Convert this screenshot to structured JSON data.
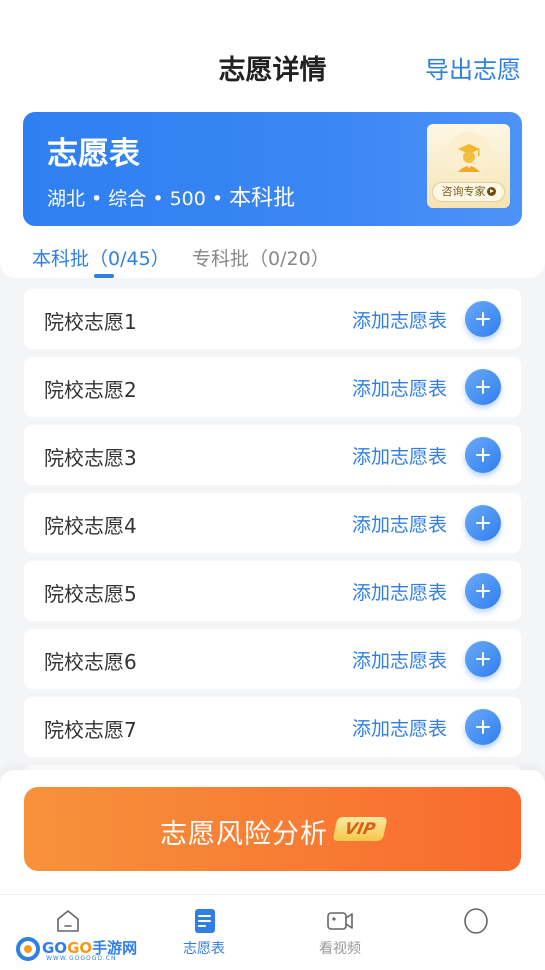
{
  "header": {
    "title": "志愿详情",
    "export_label": "导出志愿"
  },
  "banner": {
    "title": "志愿表",
    "subtitle_small": "湖北 • 综合 • 500 • ",
    "subtitle_big": "本科批",
    "expert_button": "咨询专家"
  },
  "tabs": [
    {
      "label": "本科批（0/45）",
      "active": true
    },
    {
      "label": "专科批（0/20）",
      "active": false
    }
  ],
  "list": {
    "add_label": "添加志愿表",
    "items": [
      {
        "label": "院校志愿1"
      },
      {
        "label": "院校志愿2"
      },
      {
        "label": "院校志愿3"
      },
      {
        "label": "院校志愿4"
      },
      {
        "label": "院校志愿5"
      },
      {
        "label": "院校志愿6"
      },
      {
        "label": "院校志愿7"
      }
    ]
  },
  "risk": {
    "label": "志愿风险分析",
    "badge": "VIP"
  },
  "tabbar": {
    "items": [
      {
        "label": "",
        "icon": "home-icon"
      },
      {
        "label": "志愿表",
        "icon": "document-icon",
        "active": true
      },
      {
        "label": "看视频",
        "icon": "video-icon"
      },
      {
        "label": "",
        "icon": "profile-icon"
      }
    ]
  },
  "watermark": {
    "text_blue": "GO",
    "text_orange": "GO",
    "text_cn": "手游网",
    "sub": "WWW.GOGOGO.CN"
  },
  "colors": {
    "primary": "#2f7fe5",
    "accent_orange": "#f86a2e",
    "background": "#f4f5f7"
  }
}
